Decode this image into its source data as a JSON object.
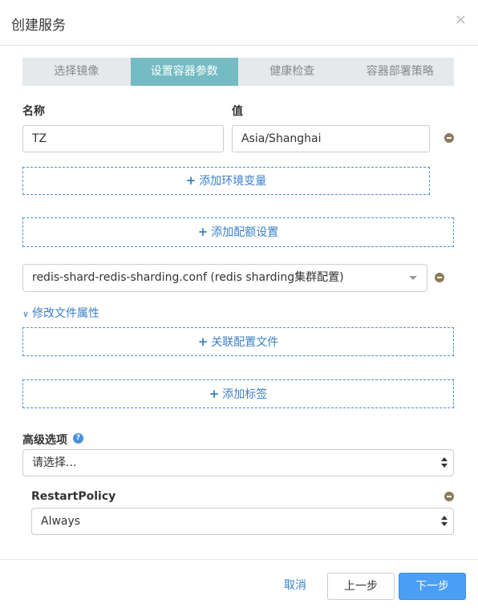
{
  "dialog": {
    "title": "创建服务",
    "close_glyph": "×"
  },
  "steps": [
    {
      "label": "选择镜像",
      "active": false
    },
    {
      "label": "设置容器参数",
      "active": true
    },
    {
      "label": "健康检查",
      "active": false
    },
    {
      "label": "容器部署策略",
      "active": false
    }
  ],
  "env": {
    "name_label": "名称",
    "value_label": "值",
    "name_value": "TZ",
    "value_value": "Asia/Shanghai",
    "add_env_label": "添加环境变量"
  },
  "quota": {
    "add_label": "添加配额设置"
  },
  "config": {
    "selected": "redis-shard-redis-sharding.conf (redis sharding集群配置)",
    "modify_label": "修改文件属性",
    "modify_icon": "chevron-double-down-icon",
    "link_label": "关联配置文件"
  },
  "tags": {
    "add_label": "添加标签"
  },
  "advanced": {
    "label": "高级选项",
    "help_glyph": "?",
    "select_value": "请选择...",
    "policy_label": "RestartPolicy",
    "policy_value": "Always"
  },
  "footer": {
    "cancel_label": "取消",
    "prev_label": "上一步",
    "next_label": "下一步"
  },
  "colors": {
    "accent": "#74bbc3",
    "link": "#3a7fc8",
    "primary": "#4a9ff5",
    "remove": "#8a7a5a"
  }
}
